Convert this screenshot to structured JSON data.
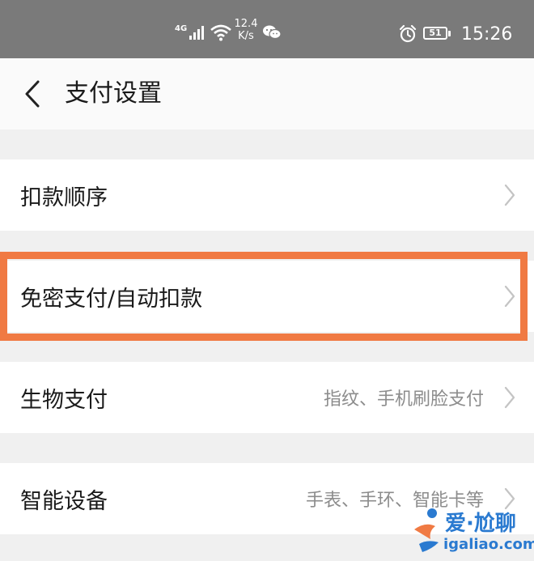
{
  "status_bar": {
    "network_label": "4G",
    "speed_value": "12.4",
    "speed_unit": "K/s",
    "battery_level": "51",
    "time": "15:26",
    "icons": [
      "signal-icon",
      "wifi-icon",
      "wechat-icon",
      "alarm-icon",
      "battery-icon"
    ]
  },
  "header": {
    "title": "支付设置",
    "back_icon": "chevron-left-icon"
  },
  "settings": {
    "items": [
      {
        "label": "扣款顺序",
        "value": ""
      },
      {
        "label": "免密支付/自动扣款",
        "value": ""
      },
      {
        "label": "生物支付",
        "value": "指纹、手机刷脸支付"
      },
      {
        "label": "智能设备",
        "value": "手表、手环、智能卡等"
      }
    ]
  },
  "highlight": {
    "color": "#f07a43",
    "target": "settings.items.1"
  },
  "watermark": {
    "line1": "爱·尬聊",
    "line2": "igaliao.com"
  },
  "colors": {
    "status_bar_bg": "#7a7a7a",
    "page_bg": "#f0f0f0",
    "row_bg": "#ffffff",
    "text_primary": "#1a1a1a",
    "text_secondary": "#8c8c8c",
    "watermark_blue": "#2a7ad0",
    "watermark_orange": "#f07a43"
  }
}
